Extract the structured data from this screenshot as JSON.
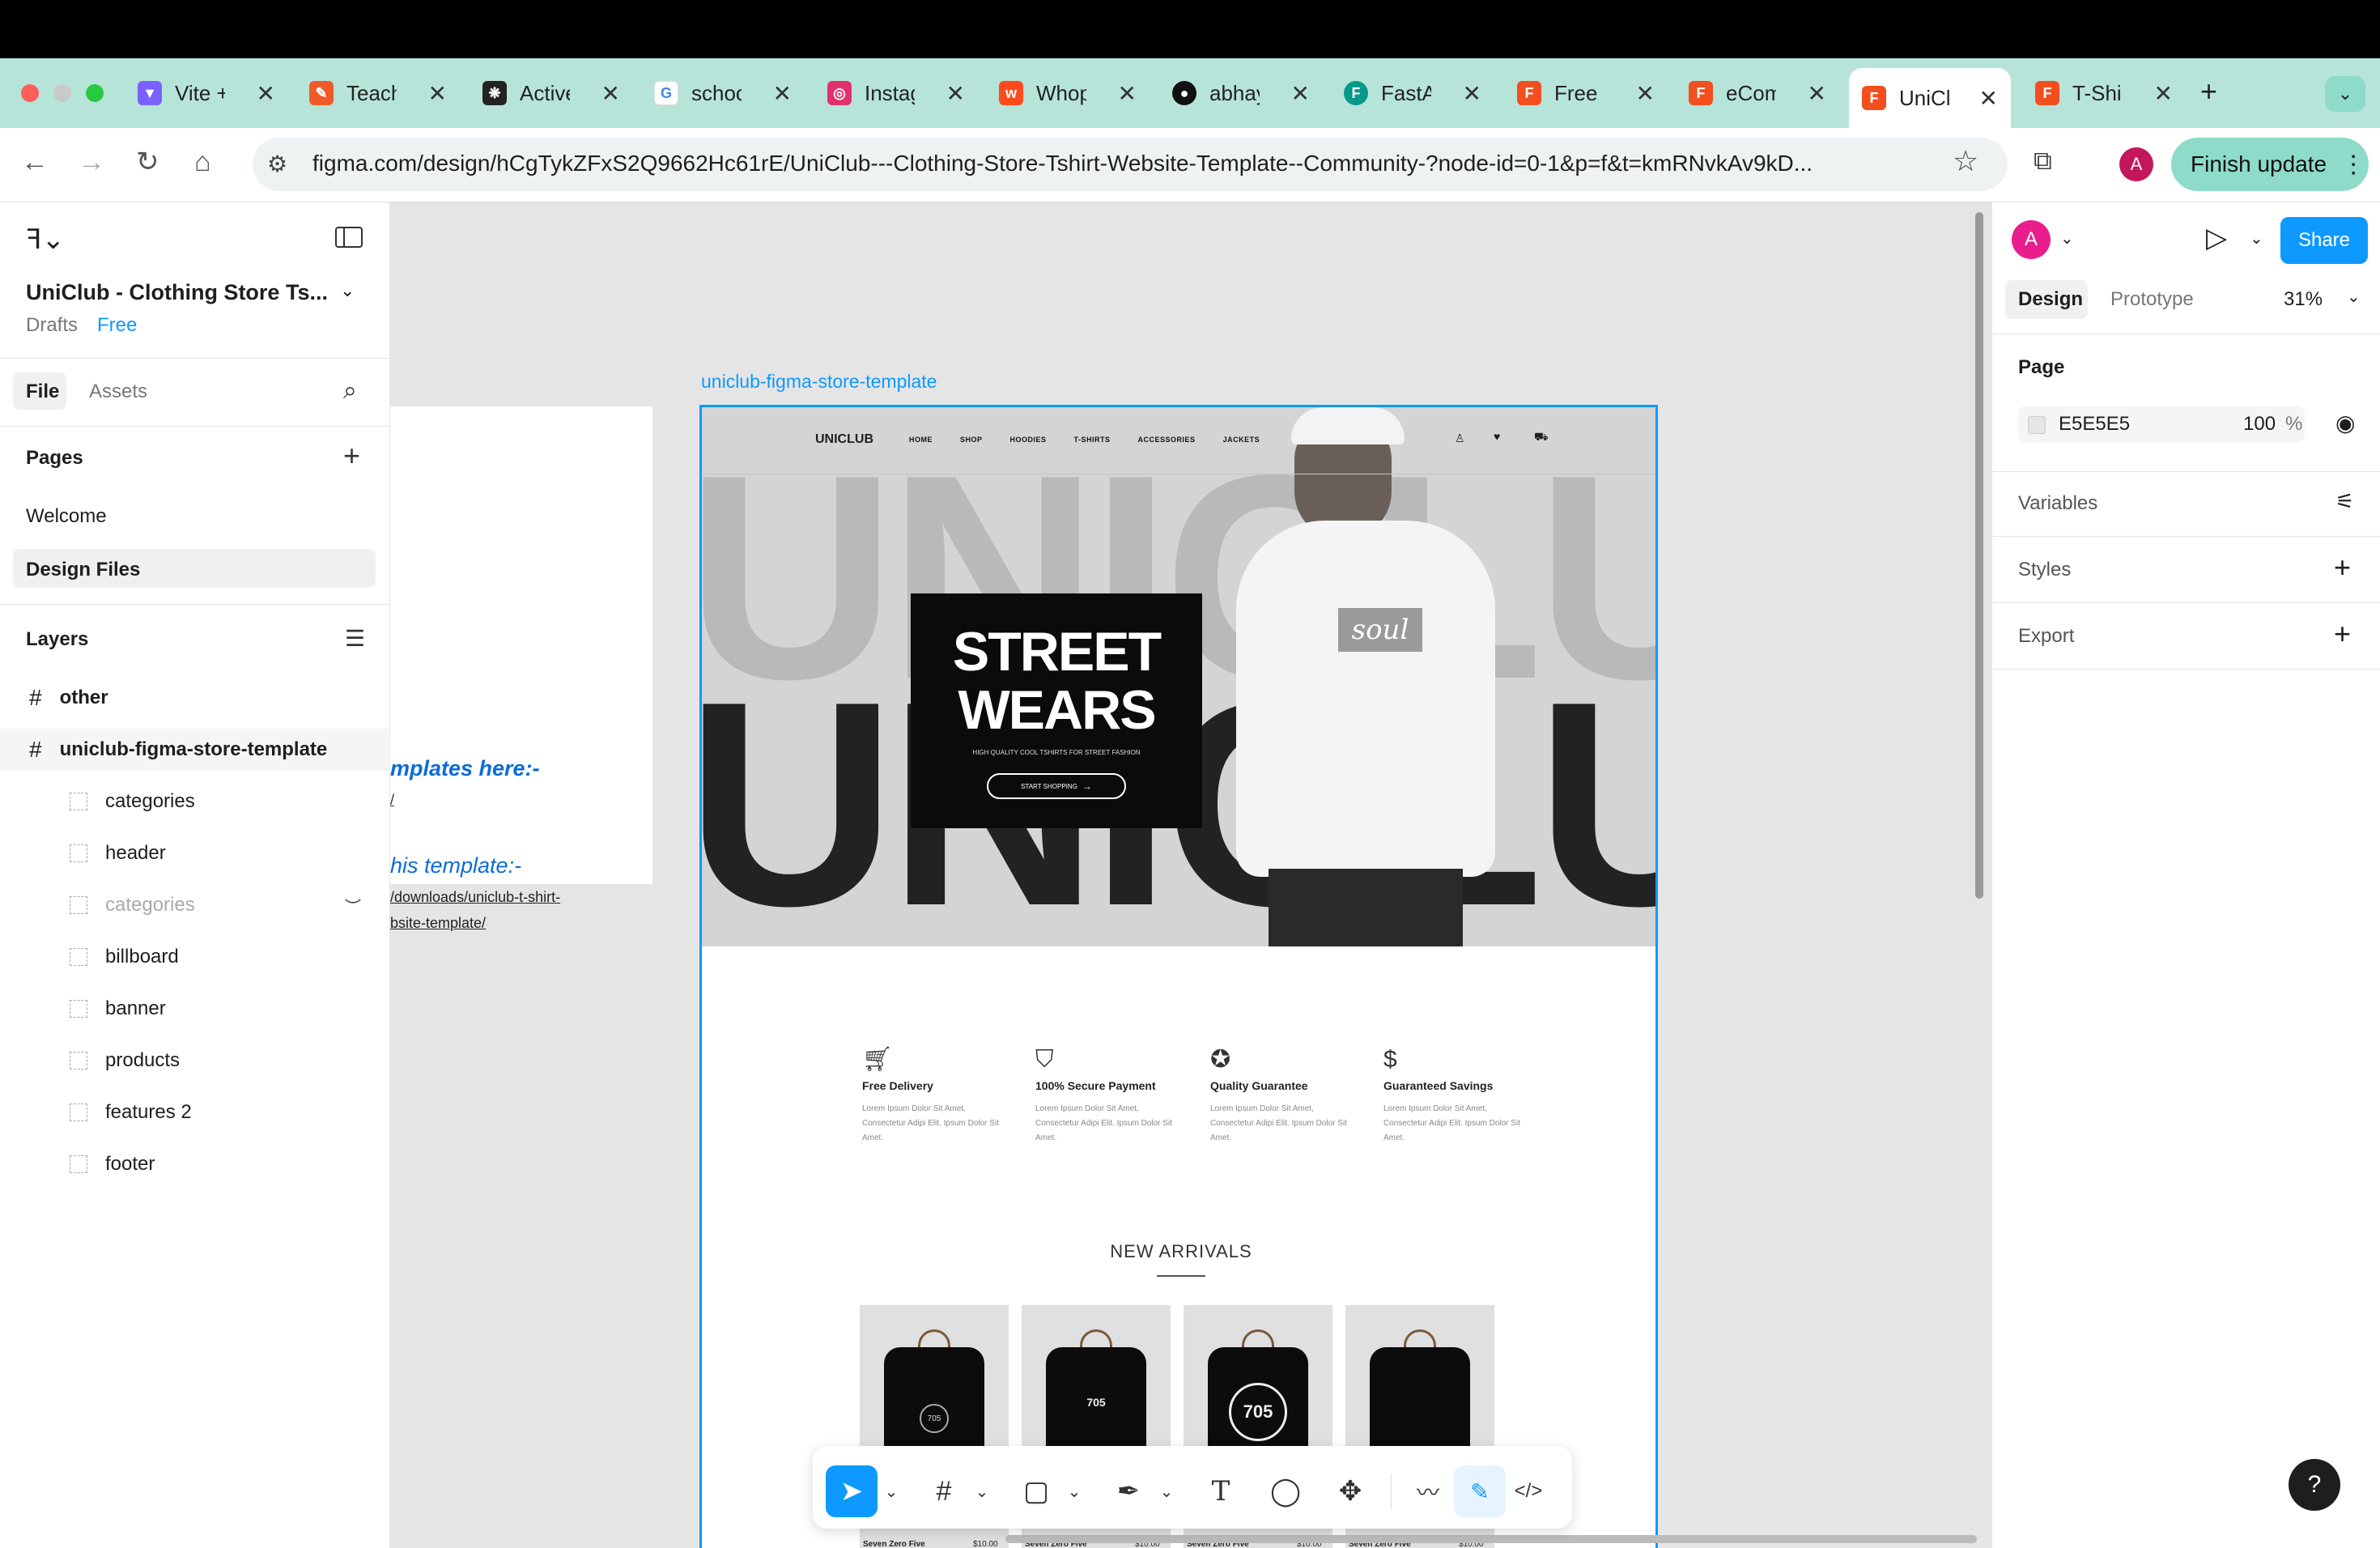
{
  "browser": {
    "tabs": [
      {
        "title": "Vite +",
        "color": "#7b61ff"
      },
      {
        "title": "Teache",
        "color": "#f05a28"
      },
      {
        "title": "Active",
        "color": "#222222"
      },
      {
        "title": "school",
        "color": "#4285f4"
      },
      {
        "title": "Instag",
        "color": "#e1306c"
      },
      {
        "title": "Whop",
        "color": "#ff4a1c"
      },
      {
        "title": "abhay",
        "color": "#111111"
      },
      {
        "title": "FastAI",
        "color": "#05998b"
      },
      {
        "title": "Free E",
        "color": "#f24e1e"
      },
      {
        "title": "eCom",
        "color": "#f24e1e"
      },
      {
        "title": "UniClu",
        "color": "#f24e1e",
        "active": true
      },
      {
        "title": "T-Shir",
        "color": "#f24e1e"
      }
    ],
    "url": "figma.com/design/hCgTykZFxS2Q9662Hc61rE/UniClub---Clothing-Store-Tshirt-Website-Template--Community-?node-id=0-1&p=f&t=kmRNvkAv9kD...",
    "profile_initial": "A",
    "finish_update": "Finish update"
  },
  "left_panel": {
    "file_title": "UniClub - Clothing Store Ts...",
    "drafts": "Drafts",
    "plan": "Free",
    "tab_file": "File",
    "tab_assets": "Assets",
    "pages_heading": "Pages",
    "pages": [
      "Welcome",
      "Design Files"
    ],
    "layers_heading": "Layers",
    "layers": [
      {
        "name": "other",
        "type": "frame"
      },
      {
        "name": "uniclub-figma-store-template",
        "type": "frame"
      },
      {
        "name": "categories",
        "type": "section"
      },
      {
        "name": "header",
        "type": "section"
      },
      {
        "name": "categories",
        "type": "section",
        "hidden": true
      },
      {
        "name": "billboard",
        "type": "section"
      },
      {
        "name": "banner",
        "type": "section"
      },
      {
        "name": "products",
        "type": "section"
      },
      {
        "name": "features 2",
        "type": "section"
      },
      {
        "name": "footer",
        "type": "section"
      }
    ]
  },
  "canvas": {
    "other_frame": {
      "line1": "mplates here:-",
      "line2": "/",
      "line3": "his template:-",
      "line4": "/downloads/uniclub-t-shirt-",
      "line5": "bsite-template/"
    },
    "frame_label": "uniclub-figma-store-template",
    "site": {
      "logo": "UNICLUB",
      "nav": [
        "HOME",
        "SHOP",
        "HOODIES",
        "T-SHIRTS",
        "ACCESSORIES",
        "JACKETS"
      ],
      "hero_bg_text": "UNICLUB",
      "hero_title_1": "STREET",
      "hero_title_2": "WEARS",
      "hero_sub": "HIGH QUALITY COOL TSHIRTS FOR STREET FASHION",
      "hero_cta": "START SHOPPING",
      "hoodie_print": "soul",
      "features": [
        {
          "title": "Free Delivery",
          "desc": "Lorem Ipsum Dolor Sit Amet, Consectetur Adipi Elit. Ipsum Dolor Sit Amet."
        },
        {
          "title": "100% Secure Payment",
          "desc": "Lorem Ipsum Dolor Sit Amet, Consectetur Adipi Elit. Ipsum Dolor Sit Amet."
        },
        {
          "title": "Quality Guarantee",
          "desc": "Lorem Ipsum Dolor Sit Amet, Consectetur Adipi Elit. Ipsum Dolor Sit Amet."
        },
        {
          "title": "Guaranteed Savings",
          "desc": "Lorem Ipsum Dolor Sit Amet, Consectetur Adipi Elit. Ipsum Dolor Sit Amet."
        }
      ],
      "new_arrivals": "NEW ARRIVALS",
      "products": [
        {
          "name": "Seven Zero Five",
          "price": "$10.00",
          "print": "705"
        },
        {
          "name": "Seven Zero Five",
          "price": "$10.00",
          "print": "705"
        },
        {
          "name": "Seven Zero Five",
          "price": "$10.00",
          "print": "705"
        },
        {
          "name": "Seven Zero Five",
          "price": "$10.00",
          "print": ""
        }
      ]
    }
  },
  "right_panel": {
    "avatar_initial": "A",
    "share": "Share",
    "tab_design": "Design",
    "tab_prototype": "Prototype",
    "zoom": "31%",
    "page_heading": "Page",
    "bg_hex": "E5E5E5",
    "bg_opacity": "100",
    "bg_percent": "%",
    "variables": "Variables",
    "styles": "Styles",
    "export": "Export"
  },
  "help": "?",
  "colors": {
    "figma_blue": "#0d99ff",
    "tab_strip": "#b7e4d9",
    "canvas_bg": "#e5e5e5"
  }
}
